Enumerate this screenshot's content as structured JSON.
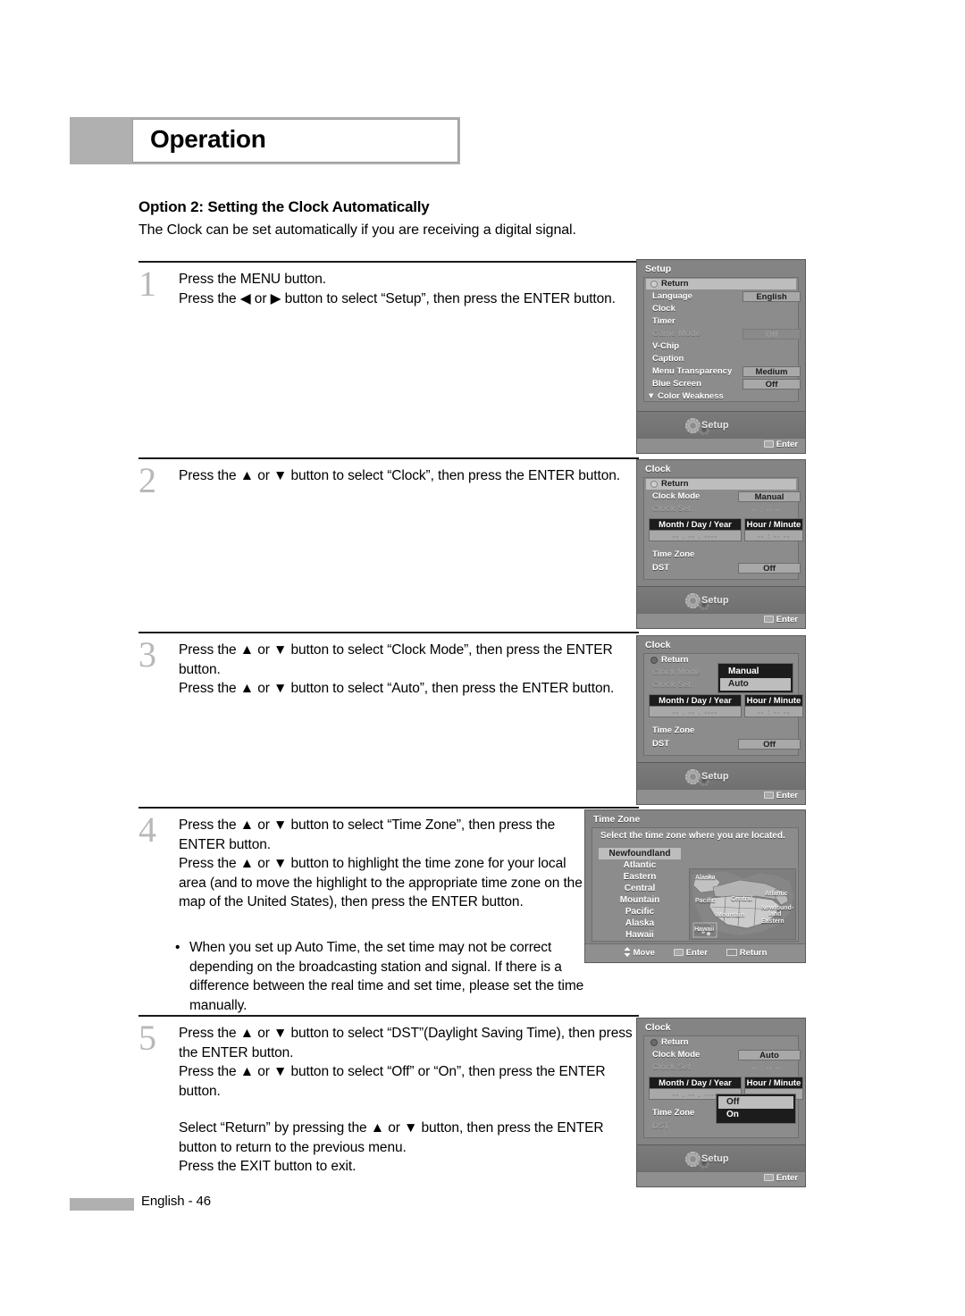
{
  "header": {
    "title": "Operation"
  },
  "section": {
    "title": "Option 2: Setting the Clock Automatically",
    "subtitle": "The Clock can be set automatically if you are receiving a digital signal."
  },
  "steps": [
    {
      "number": "1",
      "lines": [
        "Press the MENU button.",
        "Press the ◀ or ▶ button to select “Setup”, then press the ENTER button."
      ]
    },
    {
      "number": "2",
      "lines": [
        "Press the ▲ or ▼ button to select “Clock”, then press the ENTER button."
      ]
    },
    {
      "number": "3",
      "lines": [
        "Press the ▲ or ▼ button to select “Clock Mode”, then press the ENTER button.",
        "Press the ▲ or ▼ button to select “Auto”, then press the ENTER button."
      ]
    },
    {
      "number": "4",
      "lines": [
        "Press the ▲ or ▼ button to select “Time Zone”, then press the ENTER button.",
        "Press the ▲ or ▼ button to highlight the time zone for your local area (and to move the highlight to the appropriate time zone on the map of the United States), then press the ENTER button."
      ],
      "bullet": {
        "marker": "•",
        "text": "When you set up Auto Time, the set time may not be correct depending on the broadcasting station and signal. If there is a difference between the real time and set time, please set the time manually."
      }
    },
    {
      "number": "5",
      "lines": [
        "Press the ▲ or ▼ button to select “DST”(Daylight Saving Time), then press the ENTER button.",
        "Press the ▲ or ▼ button to select “Off” or “On”, then press the ENTER button.",
        "Select “Return” by pressing the ▲ or ▼ button, then press the ENTER button to return to the previous menu.",
        "Press the EXIT button to exit."
      ]
    }
  ],
  "osd": {
    "setup_menu": {
      "title": "Setup",
      "return_label": "Return",
      "rows": [
        {
          "label": "Language",
          "value": "English",
          "dim": false
        },
        {
          "label": "Clock",
          "value": "",
          "dim": false
        },
        {
          "label": "Timer",
          "value": "",
          "dim": false
        },
        {
          "label": "Game Mode",
          "value": "Off",
          "dim": true
        },
        {
          "label": "V-Chip",
          "value": "",
          "dim": false
        },
        {
          "label": "Caption",
          "value": "",
          "dim": false
        },
        {
          "label": "Menu Transparency",
          "value": "Medium",
          "dim": false
        },
        {
          "label": "Blue Screen",
          "value": "Off",
          "dim": false
        },
        {
          "label": "▼ Color Weakness",
          "value": "",
          "dim": false
        }
      ],
      "footer_label": "Setup",
      "enter_label": "Enter"
    },
    "clock_manual": {
      "title": "Clock",
      "return_label": "Return",
      "clock_mode_label": "Clock Mode",
      "clock_mode_value": "Manual",
      "clock_set_label": "Clock Set",
      "clock_set_value": "-- : -- --",
      "date_head": "Month / Day / Year",
      "date_value": "--  .  --  .  ----",
      "time_head": "Hour / Minute",
      "time_value": "--  :  --     --",
      "time_zone_label": "Time Zone",
      "dst_label": "DST",
      "dst_value": "Off",
      "footer_label": "Setup",
      "enter_label": "Enter"
    },
    "clock_mode_dropdown": {
      "title": "Clock",
      "return_label": "Return",
      "clock_mode_label": "Clock Mode",
      "clock_set_label": "Clock Set",
      "options": [
        "Manual",
        "Auto"
      ],
      "selected": "Auto",
      "date_head": "Month / Day / Year",
      "date_value": "--  .  --  .  ----",
      "time_head": "Hour / Minute",
      "time_value": "--  :  --     --",
      "time_zone_label": "Time Zone",
      "dst_label": "DST",
      "dst_value": "Off",
      "footer_label": "Setup",
      "enter_label": "Enter"
    },
    "time_zone": {
      "title": "Time Zone",
      "description": "Select the time zone where you are located.",
      "zones": [
        "Newfoundland",
        "Atlantic",
        "Eastern",
        "Central",
        "Mountain",
        "Pacific",
        "Alaska",
        "Hawaii"
      ],
      "selected": "Newfoundland",
      "map_labels": [
        "Alaska",
        "Pacific",
        "Central",
        "Atlantic",
        "Newfound-",
        "land",
        "Mountain",
        "Eastern",
        "Hawaii"
      ],
      "nav": {
        "move": "Move",
        "enter": "Enter",
        "return": "Return"
      }
    },
    "clock_dst": {
      "title": "Clock",
      "return_label": "Return",
      "clock_mode_label": "Clock Mode",
      "clock_mode_value": "Auto",
      "clock_set_label": "Clock Set",
      "clock_set_value": "-- : -- --",
      "date_head": "Month / Day / Year",
      "date_value": "--  .  --  .  ----",
      "time_head": "Hour / Minute",
      "time_value": "--  :  --     --",
      "time_zone_label": "Time Zone",
      "dst_label": "DST",
      "options": [
        "Off",
        "On"
      ],
      "selected": "Off",
      "footer_label": "Setup",
      "enter_label": "Enter"
    }
  },
  "footer": {
    "page_label": "English - 46"
  }
}
